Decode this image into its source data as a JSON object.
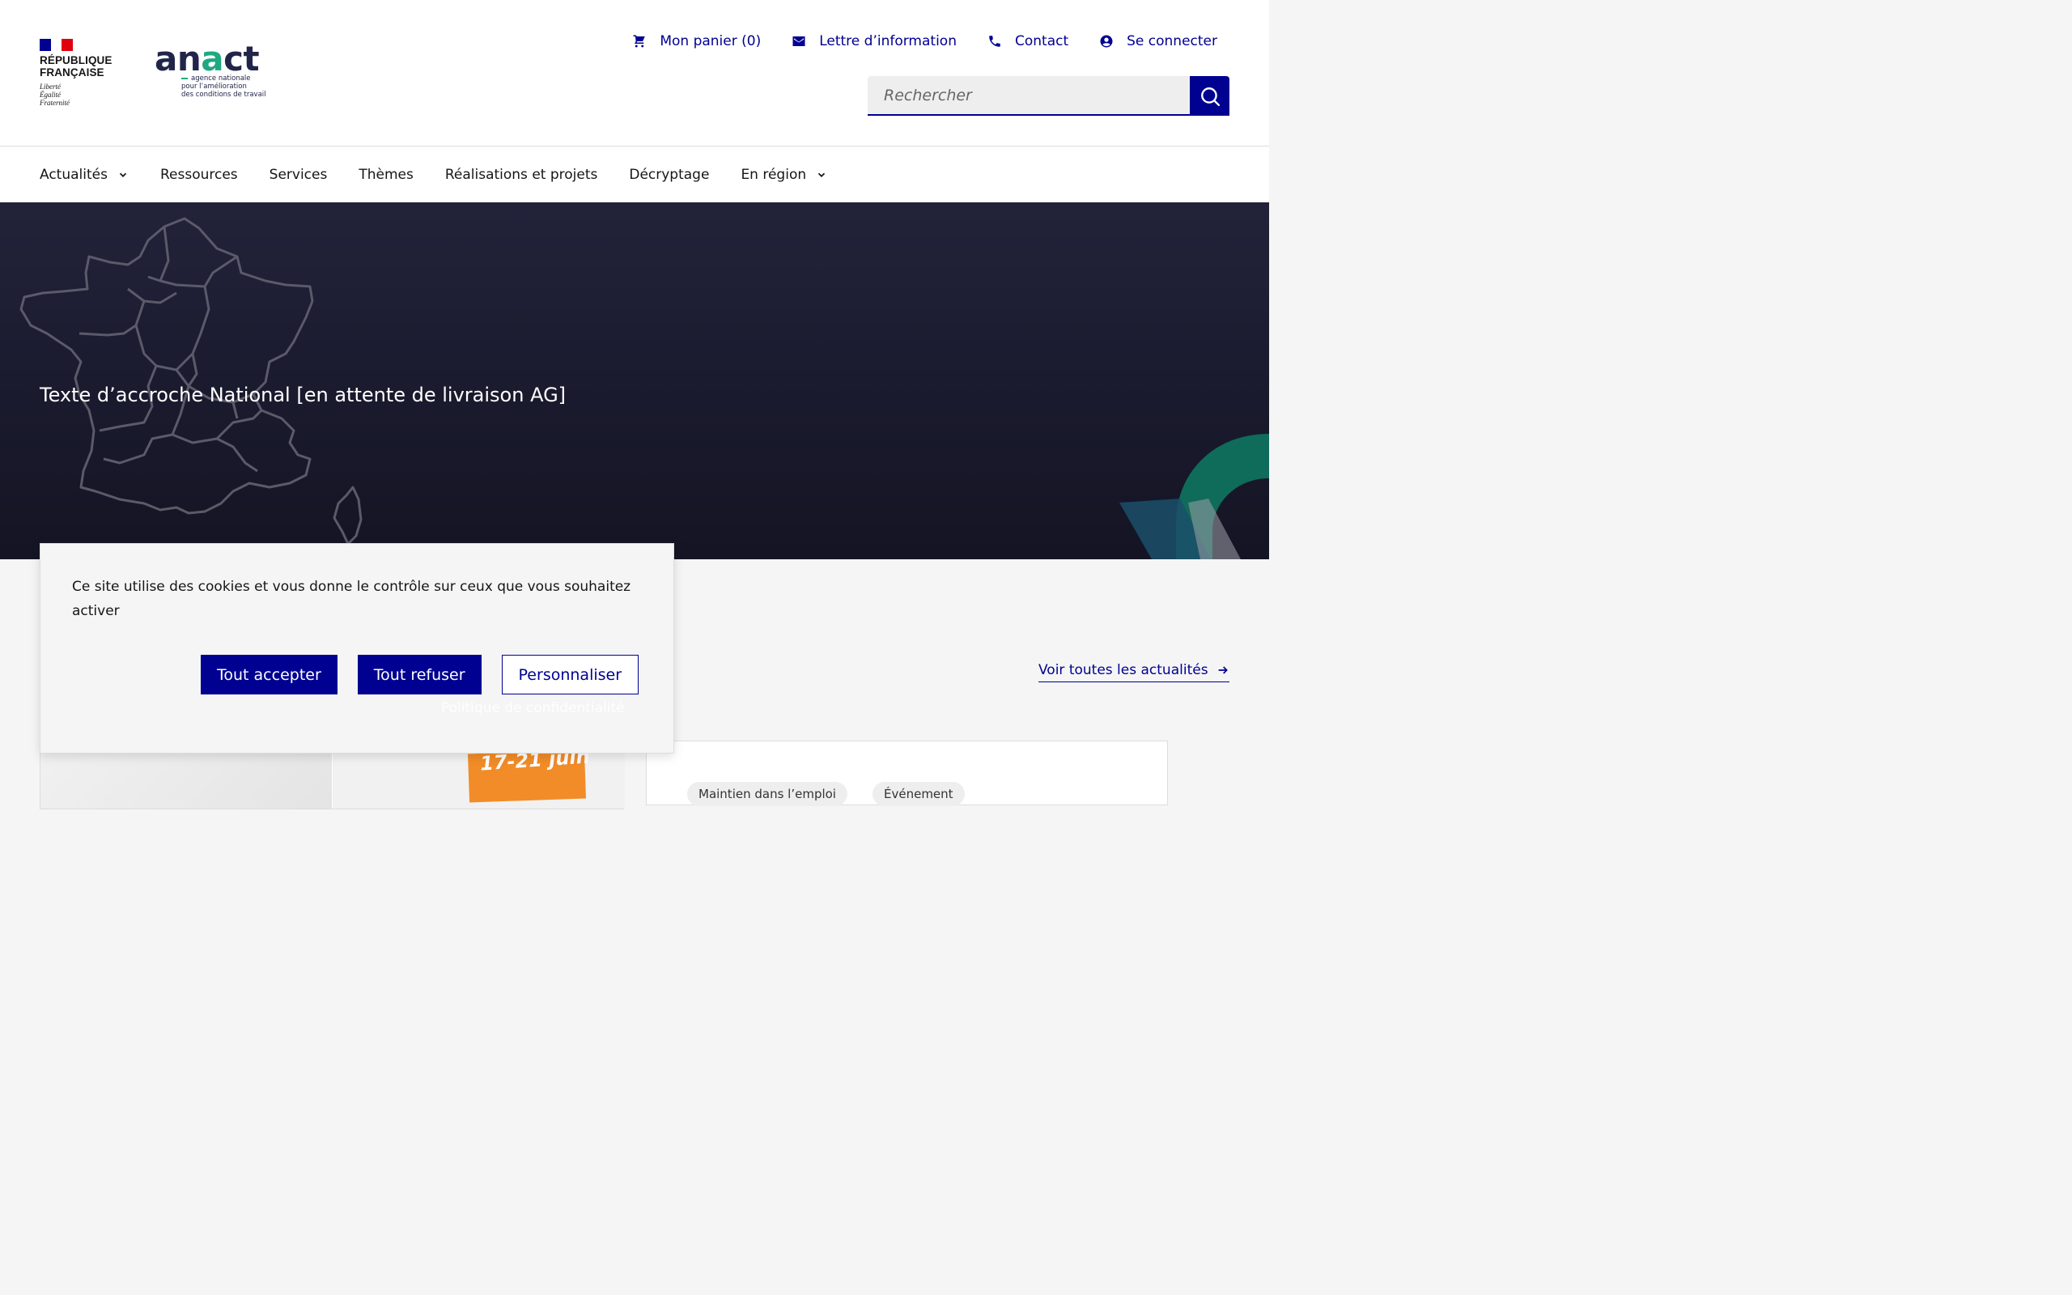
{
  "header": {
    "gov_logo": {
      "name_line1": "RÉPUBLIQUE",
      "name_line2": "FRANÇAISE",
      "motto_1": "Liberté",
      "motto_2": "Égalité",
      "motto_3": "Fraternité"
    },
    "brand_logo": {
      "word": "anact",
      "sub_line1": "agence nationale",
      "sub_line2": "pour l’amélioration",
      "sub_line3": "des conditions de travail"
    },
    "links": {
      "cart": "Mon panier (0)",
      "newsletter": "Lettre d’information",
      "contact": "Contact",
      "login": "Se connecter"
    },
    "search": {
      "placeholder": "Rechercher"
    }
  },
  "nav": {
    "items": [
      "Actualités",
      "Ressources",
      "Services",
      "Thèmes",
      "Réalisations et projets",
      "Décryptage",
      "En région"
    ]
  },
  "hero": {
    "text": "Texte d’accroche National [en attente de livraison AG]"
  },
  "news": {
    "see_all": "Voir toutes les actualités",
    "card_image_text": "17-21 juin",
    "tags": [
      "Maintien dans l’emploi",
      "Événement"
    ]
  },
  "cookie": {
    "text": "Ce site utilise des cookies et vous donne le contrôle sur ceux que vous souhaitez activer",
    "accept": "Tout accepter",
    "refuse": "Tout refuser",
    "customize": "Personnaliser",
    "privacy": "Politique de confidentialité"
  },
  "colors": {
    "primary": "#000091",
    "hero_bg": "#1b1b2e",
    "accent_green": "#1fa882"
  }
}
